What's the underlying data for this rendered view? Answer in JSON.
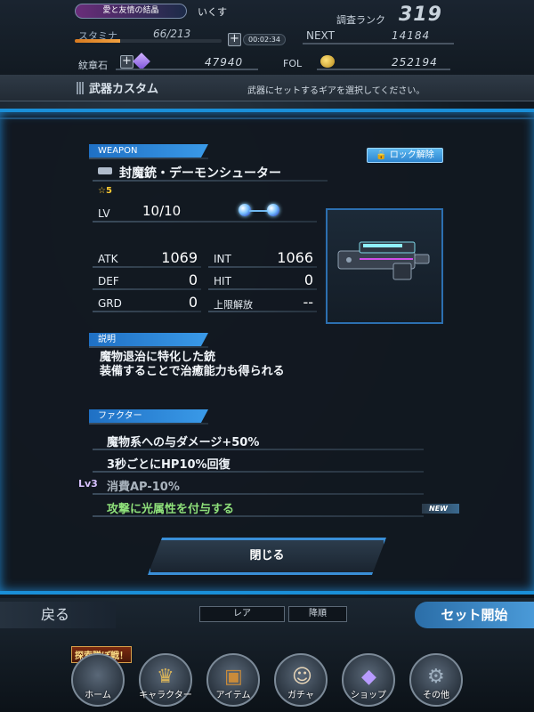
{
  "status": {
    "title_badge": "愛と友情の結晶",
    "player_name": "いくす",
    "rank_label": "調査ランク",
    "rank_value": "319",
    "stamina_label": "スタミナ",
    "stamina_value": "66/213",
    "stamina_fraction": 0.31,
    "timer": "00:02:34",
    "next_label": "NEXT",
    "next_value": "14184",
    "crest_label": "紋章石",
    "crest_value": "47940",
    "fol_label": "FOL",
    "fol_value": "252194",
    "plus": "+"
  },
  "header": {
    "title": "武器カスタム",
    "message": "武器にセットするギアを選択してください。"
  },
  "weapon": {
    "section_label": "WEAPON",
    "name": "封魔銃・デーモンシューター",
    "lock_button": "ロック解除",
    "rarity": "☆5",
    "lv_label": "LV",
    "lv_value": "10/10",
    "stats": {
      "atk_label": "ATK",
      "atk_value": "1069",
      "int_label": "INT",
      "int_value": "1066",
      "def_label": "DEF",
      "def_value": "0",
      "hit_label": "HIT",
      "hit_value": "0",
      "grd_label": "GRD",
      "grd_value": "0",
      "limit_label": "上限解放",
      "limit_value": "--"
    }
  },
  "description": {
    "section_label": "説明",
    "line1": "魔物退治に特化した銃",
    "line2": "装備することで治癒能力も得られる"
  },
  "factors": {
    "section_label": "ファクター",
    "items": [
      "魔物系への与ダメージ+50%",
      "3秒ごとにHP10%回復",
      "消費AP-10%",
      "攻撃に光属性を付与する"
    ],
    "lock_level": "Lv3",
    "new_badge": "NEW"
  },
  "close_button": "閉じる",
  "footer": {
    "back": "戻る",
    "sort_rarity": "レア",
    "sort_order": "降順",
    "set_start": "セット開始",
    "banner": "探索隊ぼ戦！",
    "nav": [
      "ホーム",
      "キャラクター",
      "アイテム",
      "ガチャ",
      "ショップ",
      "その他"
    ]
  },
  "colors": {
    "accent": "#1a8fd8",
    "factor_new": "#8ee07a",
    "stamina_bar": "#e08a2a"
  }
}
